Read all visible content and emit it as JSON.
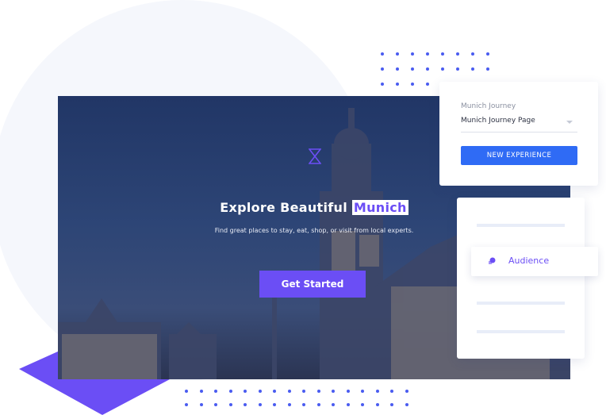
{
  "hero": {
    "title": "Explore Beautiful",
    "title_highlight": "Munich",
    "subtitle": "Find great places to stay, eat, shop, or visit from local experts.",
    "cta_label": "Get Started"
  },
  "experience_card": {
    "label": "Munich Journey",
    "selected_page": "Munich Journey Page",
    "button_label": "NEW EXPERIENCE"
  },
  "audience_card": {
    "label": "Audience",
    "icon": "audience-icon"
  },
  "colors": {
    "accent": "#6b4ef5",
    "primary_button": "#2f6bf5",
    "dots": "#4a5cf0"
  }
}
